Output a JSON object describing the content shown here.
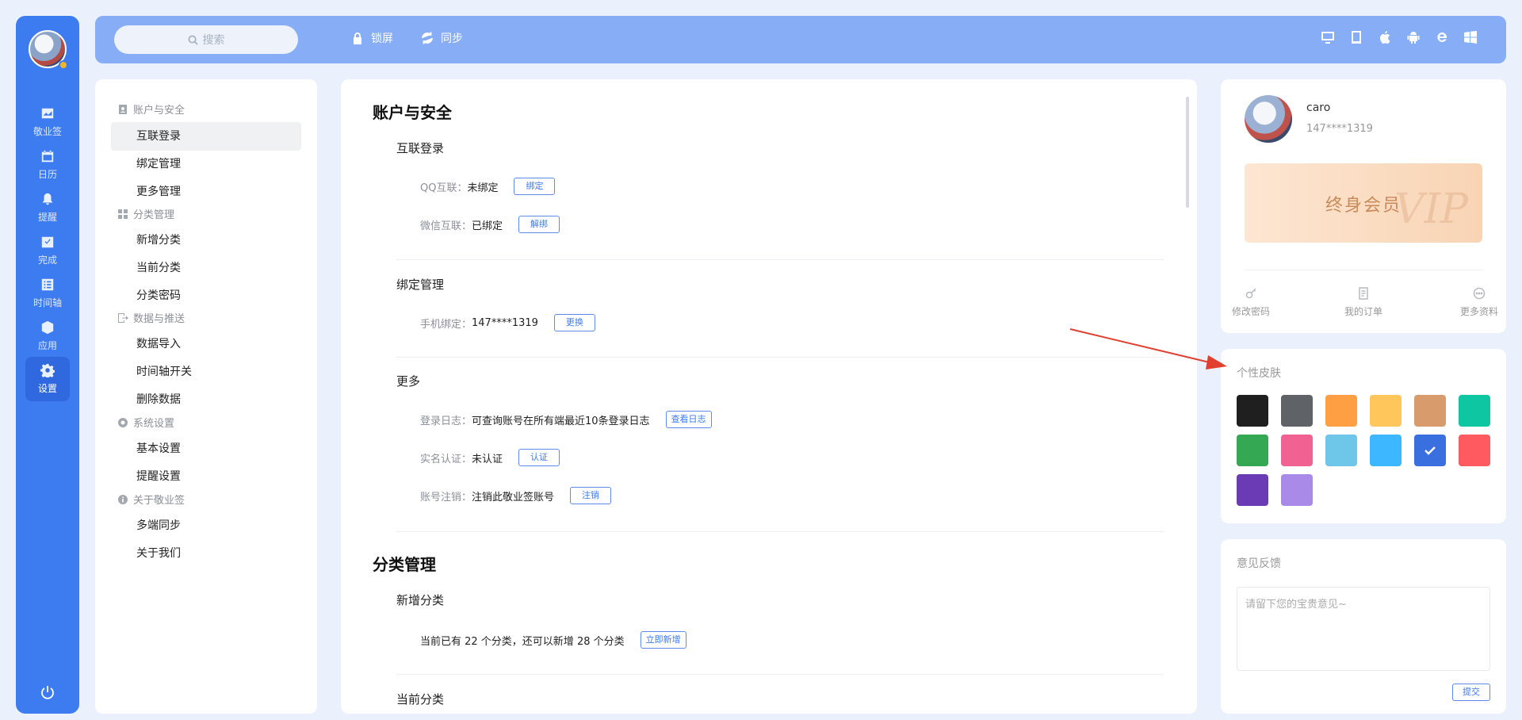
{
  "rail": {
    "items": [
      {
        "label": "敬业签",
        "icon": "note-icon"
      },
      {
        "label": "日历",
        "icon": "calendar-icon"
      },
      {
        "label": "提醒",
        "icon": "bell-icon"
      },
      {
        "label": "完成",
        "icon": "check-square-icon"
      },
      {
        "label": "时间轴",
        "icon": "timeline-icon"
      },
      {
        "label": "应用",
        "icon": "cube-icon"
      },
      {
        "label": "设置",
        "icon": "gear-icon"
      }
    ],
    "active_index": 6
  },
  "topbar": {
    "search_placeholder": "搜索",
    "lock_label": "锁屏",
    "sync_label": "同步",
    "platforms": [
      "desktop-icon",
      "tablet-icon",
      "apple-icon",
      "android-icon",
      "ie-icon",
      "windows-icon"
    ]
  },
  "menu": {
    "groups": [
      {
        "label": "账户与安全",
        "icon": "account-icon"
      },
      {
        "label": "分类管理",
        "icon": "grid-icon"
      },
      {
        "label": "数据与推送",
        "icon": "export-icon"
      },
      {
        "label": "系统设置",
        "icon": "gear-icon"
      },
      {
        "label": "关于敬业签",
        "icon": "info-icon"
      }
    ],
    "items": [
      "互联登录",
      "绑定管理",
      "更多管理",
      "新增分类",
      "当前分类",
      "分类密码",
      "数据导入",
      "时间轴开关",
      "删除数据",
      "基本设置",
      "提醒设置",
      "多端同步",
      "关于我们"
    ],
    "active_item": "互联登录"
  },
  "main": {
    "account_title": "账户与安全",
    "login_title": "互联登录",
    "qq_key": "QQ互联：",
    "qq_value": "未绑定",
    "qq_btn": "绑定",
    "wechat_key": "微信互联：",
    "wechat_value": "已绑定",
    "wechat_btn": "解绑",
    "bind_title": "绑定管理",
    "phone_key": "手机绑定：",
    "phone_value": "147****1319",
    "phone_btn": "更换",
    "more_title": "更多",
    "log_key": "登录日志：",
    "log_value": "可查询账号在所有端最近10条登录日志",
    "log_btn": "查看日志",
    "realname_key": "实名认证：",
    "realname_value": "未认证",
    "realname_btn": "认证",
    "cancel_key": "账号注销：",
    "cancel_value": "注销此敬业签账号",
    "cancel_btn": "注销",
    "category_title": "分类管理",
    "new_category_title": "新增分类",
    "category_info": "当前已有 22 个分类，还可以新增 28 个分类",
    "category_btn": "立即新增",
    "current_category_title": "当前分类"
  },
  "profile": {
    "name": "caro",
    "phone": "147****1319",
    "vip_label": "终身会员",
    "vip_watermark": "VIP",
    "actions": [
      {
        "label": "修改密码",
        "icon": "key-icon"
      },
      {
        "label": "我的订单",
        "icon": "order-icon"
      },
      {
        "label": "更多资料",
        "icon": "more-icon"
      }
    ]
  },
  "skin": {
    "title": "个性皮肤",
    "colors": [
      "#1f1f1f",
      "#5f6368",
      "#ff9f43",
      "#ffc65c",
      "#d89c6c",
      "#0fc6a3",
      "#34a853",
      "#f06292",
      "#6ec6e8",
      "#3db7ff",
      "#3a6fe0",
      "#ff5a5f",
      "#6a3bb5",
      "#a98ae8"
    ],
    "selected_index": 10
  },
  "feedback": {
    "title": "意见反馈",
    "placeholder": "请留下您的宝贵意见~",
    "submit": "提交"
  }
}
